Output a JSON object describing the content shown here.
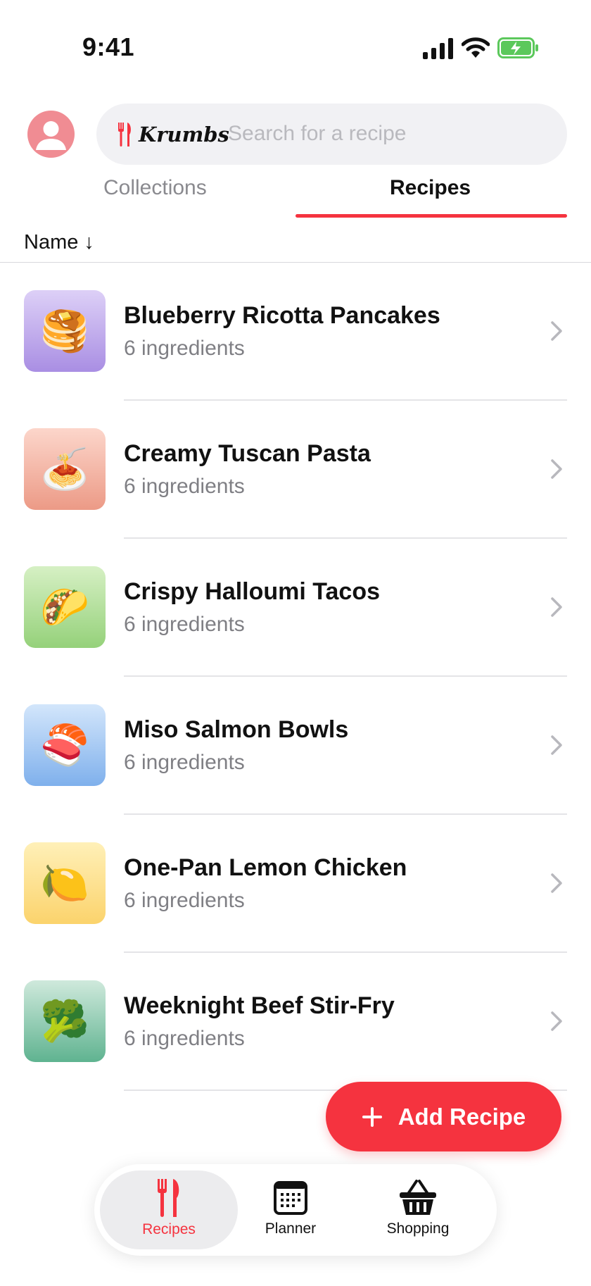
{
  "status_bar": {
    "time": "9:41"
  },
  "search": {
    "brand": "Krumbs",
    "placeholder": "Search for a recipe"
  },
  "tabs": [
    {
      "label": "Collections",
      "selected": false
    },
    {
      "label": "Recipes",
      "selected": true
    }
  ],
  "sort": {
    "label": "Name ↓"
  },
  "recipes": [
    {
      "name": "Blueberry Ricotta Pancakes",
      "subtitle": "6 ingredients",
      "emoji": "🥞",
      "gradient": [
        "#ddd0f7",
        "#a98ee3"
      ]
    },
    {
      "name": "Creamy Tuscan Pasta",
      "subtitle": "6 ingredients",
      "emoji": "🍝",
      "gradient": [
        "#fcd6cb",
        "#ec9a86"
      ]
    },
    {
      "name": "Crispy Halloumi Tacos",
      "subtitle": "6 ingredients",
      "emoji": "🌮",
      "gradient": [
        "#d6f0c4",
        "#95d17a"
      ]
    },
    {
      "name": "Miso Salmon Bowls",
      "subtitle": "6 ingredients",
      "emoji": "🍣",
      "gradient": [
        "#d3e6fb",
        "#7fb0ec"
      ]
    },
    {
      "name": "One-Pan Lemon Chicken",
      "subtitle": "6 ingredients",
      "emoji": "🍋",
      "gradient": [
        "#fff0b8",
        "#fbd36c"
      ]
    },
    {
      "name": "Weeknight Beef Stir-Fry",
      "subtitle": "6 ingredients",
      "emoji": "🥦",
      "gradient": [
        "#cfe9dc",
        "#5fb390"
      ]
    }
  ],
  "fab": {
    "label": "Add Recipe"
  },
  "tab_bar": [
    {
      "label": "Recipes",
      "icon": "fork-knife-icon",
      "active": true
    },
    {
      "label": "Planner",
      "icon": "calendar-icon",
      "active": false
    },
    {
      "label": "Shopping",
      "icon": "basket-icon",
      "active": false
    }
  ],
  "colors": {
    "accent": "#f5333f",
    "text_primary": "#111111",
    "text_secondary": "#7f7f84",
    "search_bg": "#f1f1f4",
    "battery_green": "#5bc85b"
  }
}
